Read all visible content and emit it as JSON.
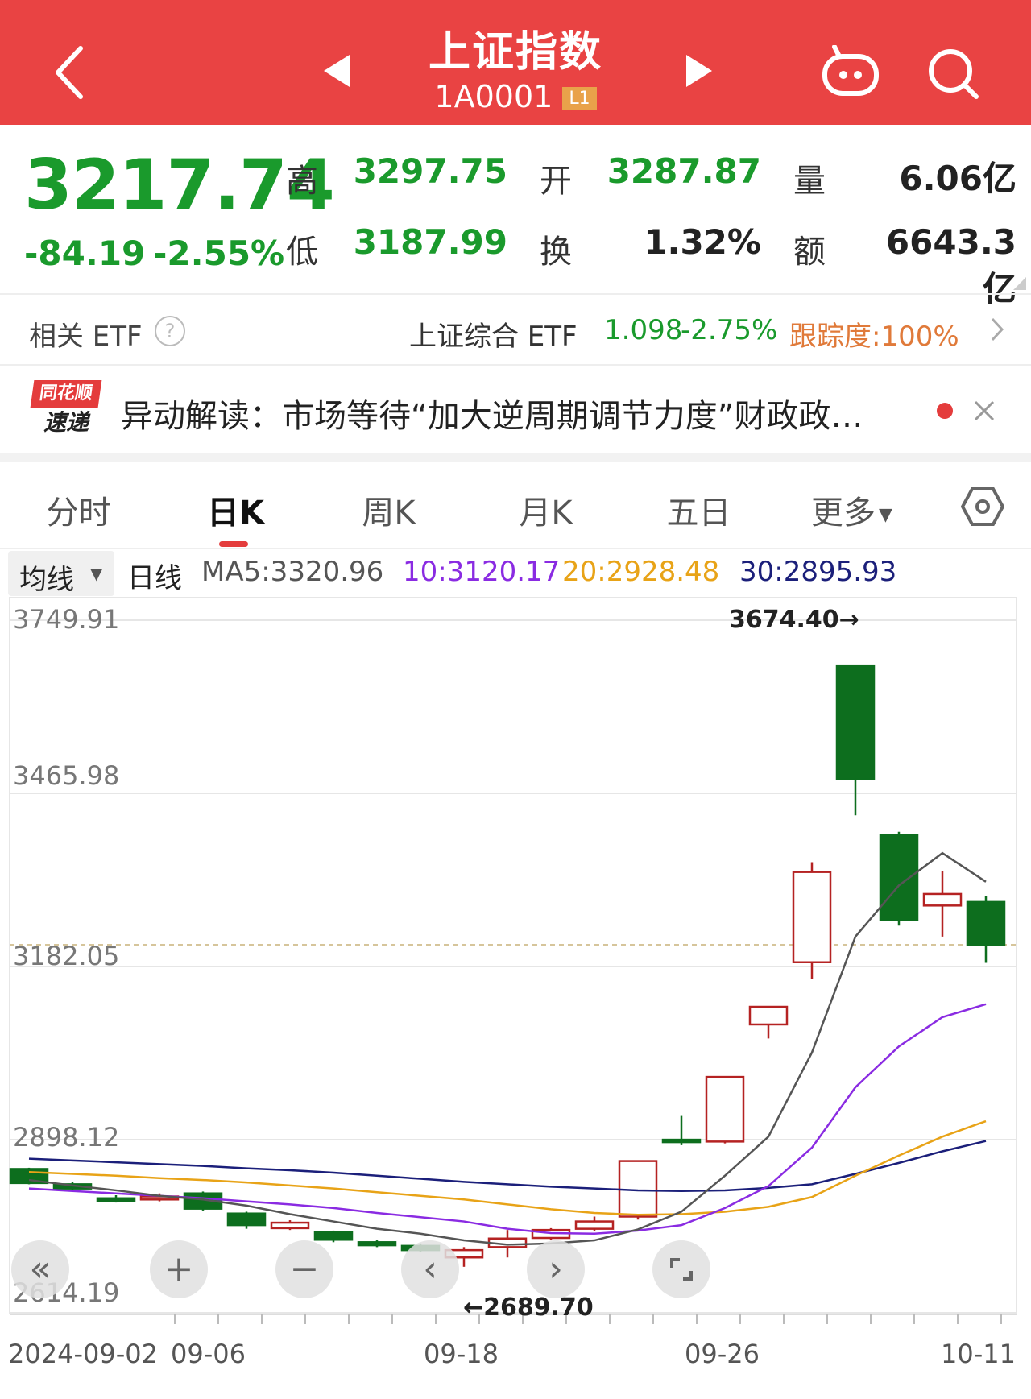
{
  "header": {
    "title": "上证指数",
    "code": "1A0001",
    "level_badge": "L1"
  },
  "quote": {
    "price": "3217.74",
    "change": "-84.19",
    "change_pct": "-2.55%",
    "high_label": "高",
    "high": "3297.75",
    "low_label": "低",
    "low": "3187.99",
    "open_label": "开",
    "open": "3287.87",
    "turnover_label": "换",
    "turnover": "1.32%",
    "volume_label": "量",
    "volume": "6.06亿",
    "amount_label": "额",
    "amount": "6643.3亿"
  },
  "etf": {
    "label": "相关 ETF",
    "name": "上证综合 ETF",
    "price": "1.098",
    "change_pct": "-2.75%",
    "tracking": "跟踪度:100%"
  },
  "news": {
    "logo_top": "同花顺",
    "logo_bottom": "速递",
    "text": "异动解读：市场等待“加大逆周期调节力度”财政政…"
  },
  "tabs": [
    {
      "label": "分时"
    },
    {
      "label": "日K"
    },
    {
      "label": "周K"
    },
    {
      "label": "月K"
    },
    {
      "label": "五日"
    },
    {
      "label": "更多"
    }
  ],
  "ma_bar": {
    "selector": "均线",
    "type": "日线",
    "ma5": "MA5:3320.96",
    "ma10": "10:3120.17",
    "ma20": "20:2928.48",
    "ma30": "30:2895.93"
  },
  "colors": {
    "header_bg": "#e94343",
    "down": "#1a9a2c",
    "up_candle": "#b52222",
    "down_candle": "#0d6e1e",
    "ma5": "#555555",
    "ma10": "#8a2be2",
    "ma20": "#e8a317",
    "ma30": "#1b1f7a",
    "etf_tracking": "#e07a3a"
  },
  "chart_data": {
    "type": "candlestick",
    "y_ticks": [
      "3749.91",
      "3465.98",
      "3182.05",
      "2898.12",
      "2614.19"
    ],
    "x_labels": [
      "2024-09-02",
      "09-06",
      "09-18",
      "09-26",
      "10-11"
    ],
    "ylim": [
      2614.19,
      3749.91
    ],
    "annotations": {
      "high": "3674.40→",
      "low": "←2689.70"
    },
    "candles": [
      {
        "o": 2850,
        "c": 2827,
        "h": 2852,
        "l": 2825
      },
      {
        "o": 2825,
        "c": 2818,
        "h": 2829,
        "l": 2813
      },
      {
        "o": 2802,
        "c": 2800,
        "h": 2807,
        "l": 2795
      },
      {
        "o": 2800,
        "c": 2805,
        "h": 2810,
        "l": 2797
      },
      {
        "o": 2810,
        "c": 2785,
        "h": 2813,
        "l": 2782
      },
      {
        "o": 2777,
        "c": 2758,
        "h": 2780,
        "l": 2752
      },
      {
        "o": 2753,
        "c": 2762,
        "h": 2766,
        "l": 2750
      },
      {
        "o": 2746,
        "c": 2734,
        "h": 2749,
        "l": 2730
      },
      {
        "o": 2730,
        "c": 2725,
        "h": 2733,
        "l": 2722
      },
      {
        "o": 2724,
        "c": 2717,
        "h": 2728,
        "l": 2714
      },
      {
        "o": 2705,
        "c": 2717,
        "h": 2722,
        "l": 2689.7
      },
      {
        "o": 2722,
        "c": 2736,
        "h": 2750,
        "l": 2705
      },
      {
        "o": 2737,
        "c": 2750,
        "h": 2753,
        "l": 2733
      },
      {
        "o": 2752,
        "c": 2764,
        "h": 2772,
        "l": 2748
      },
      {
        "o": 2772,
        "c": 2863,
        "h": 2863,
        "l": 2767
      },
      {
        "o": 2898,
        "c": 2896,
        "h": 2937,
        "l": 2889
      },
      {
        "o": 2895,
        "c": 3001,
        "h": 3001,
        "l": 2892
      },
      {
        "o": 3087,
        "c": 3116,
        "h": 3116,
        "l": 3064
      },
      {
        "o": 3189,
        "c": 3337,
        "h": 3353,
        "l": 3161
      },
      {
        "o": 3674.4,
        "c": 3489,
        "h": 3674.4,
        "l": 3430
      },
      {
        "o": 3397,
        "c": 3258,
        "h": 3403,
        "l": 3249
      },
      {
        "o": 3282,
        "c": 3301,
        "h": 3339,
        "l": 3231
      },
      {
        "o": 3287.87,
        "c": 3217.74,
        "h": 3297.75,
        "l": 3187.99
      }
    ],
    "ma5": [
      2832,
      2823,
      2815,
      2806,
      2800,
      2790,
      2776,
      2764,
      2752,
      2744,
      2733,
      2726,
      2728,
      2733,
      2751,
      2780,
      2839,
      2903,
      3041,
      3231,
      3315,
      3368,
      3320.96
    ],
    "ma10": [
      2818,
      2814,
      2810,
      2806,
      2802,
      2797,
      2792,
      2786,
      2778,
      2771,
      2764,
      2752,
      2745,
      2744,
      2749,
      2758,
      2786,
      2822,
      2885,
      2984,
      3051,
      3099,
      3120.17
    ],
    "ma20": [
      2845,
      2842,
      2839,
      2835,
      2832,
      2828,
      2823,
      2818,
      2812,
      2806,
      2800,
      2792,
      2784,
      2778,
      2775,
      2776,
      2780,
      2788,
      2804,
      2839,
      2872,
      2903,
      2928.48
    ],
    "ma30": [
      2867,
      2864,
      2861,
      2858,
      2855,
      2851,
      2848,
      2844,
      2839,
      2834,
      2829,
      2825,
      2821,
      2818,
      2815,
      2814,
      2815,
      2819,
      2825,
      2842,
      2860,
      2879,
      2895.93
    ]
  }
}
